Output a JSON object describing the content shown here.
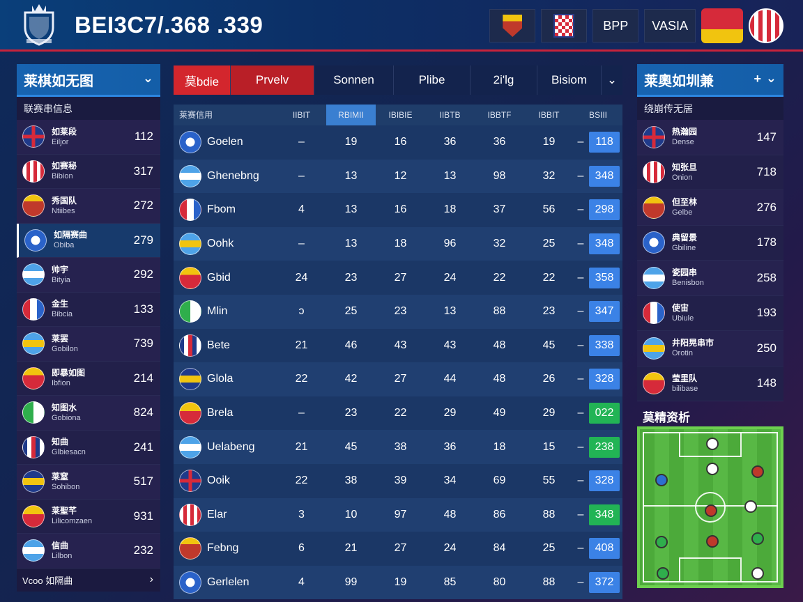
{
  "header": {
    "title": "BEI3C7/.368 .339",
    "buttons": [
      "BPP",
      "VASIA"
    ]
  },
  "left_panel": {
    "title": "莱棋如无图",
    "subtitle": "联赛串信息",
    "items": [
      {
        "name": "如莱段",
        "sub": "Eiljor",
        "value": "112"
      },
      {
        "name": "如赛秘",
        "sub": "Bibion",
        "value": "317"
      },
      {
        "name": "秀国队",
        "sub": "Ntiibes",
        "value": "272"
      },
      {
        "name": "如隔赛曲",
        "sub": "Obiba",
        "value": "279"
      },
      {
        "name": "帅宇",
        "sub": "Bityia",
        "value": "292"
      },
      {
        "name": "金生",
        "sub": "Bibcia",
        "value": "133"
      },
      {
        "name": "莱罢",
        "sub": "Gobilon",
        "value": "739"
      },
      {
        "name": "即暴如图",
        "sub": "Ibfion",
        "value": "214"
      },
      {
        "name": "知图水",
        "sub": "Gobiona",
        "value": "824"
      },
      {
        "name": "知曲",
        "sub": "Glbiesacn",
        "value": "241"
      },
      {
        "name": "莱窒",
        "sub": "Sohibon",
        "value": "517"
      },
      {
        "name": "莱聖芊",
        "sub": "Lilicomzaen",
        "value": "931"
      },
      {
        "name": "信曲",
        "sub": "Lilbon",
        "value": "232"
      }
    ],
    "footer": "Vcoo 如隔曲"
  },
  "tabs": [
    "莫bdie",
    "Prvelv",
    "Sonnen",
    "Plibe",
    "2i'lg",
    "Bisiom"
  ],
  "table": {
    "columns": [
      "莱赛信用",
      "IIBIT",
      "RBIMII",
      "IBIBIE",
      "IIBTB",
      "IBBTF",
      "IBBIT",
      "BSIII"
    ],
    "rows": [
      {
        "team": "Goelen",
        "v": [
          "–",
          "19",
          "16",
          "36",
          "36",
          "19"
        ],
        "score": "118",
        "score_color": "blue"
      },
      {
        "team": "Ghenebng",
        "v": [
          "–",
          "13",
          "12",
          "13",
          "98",
          "32"
        ],
        "score": "348",
        "score_color": "blue"
      },
      {
        "team": "Fbom",
        "v": [
          "4",
          "13",
          "16",
          "18",
          "37",
          "56"
        ],
        "score": "298",
        "score_color": "blue"
      },
      {
        "team": "Oohk",
        "v": [
          "–",
          "13",
          "18",
          "96",
          "32",
          "25"
        ],
        "score": "348",
        "score_color": "blue"
      },
      {
        "team": "Gbid",
        "v": [
          "24",
          "23",
          "27",
          "24",
          "22",
          "22"
        ],
        "score": "358",
        "score_color": "blue"
      },
      {
        "team": "Mlin",
        "v": [
          "ɔ",
          "25",
          "23",
          "13",
          "88",
          "23"
        ],
        "score": "347",
        "score_color": "blue"
      },
      {
        "team": "Bete",
        "v": [
          "21",
          "46",
          "43",
          "43",
          "48",
          "45"
        ],
        "score": "338",
        "score_color": "blue"
      },
      {
        "team": "Glola",
        "v": [
          "22",
          "42",
          "27",
          "44",
          "48",
          "26"
        ],
        "score": "328",
        "score_color": "blue"
      },
      {
        "team": "Brela",
        "v": [
          "–",
          "23",
          "22",
          "29",
          "49",
          "29"
        ],
        "score": "022",
        "score_color": "green"
      },
      {
        "team": "Uelabeng",
        "v": [
          "21",
          "45",
          "38",
          "36",
          "18",
          "15"
        ],
        "score": "238",
        "score_color": "green"
      },
      {
        "team": "Ooik",
        "v": [
          "22",
          "38",
          "39",
          "34",
          "69",
          "55"
        ],
        "score": "328",
        "score_color": "blue"
      },
      {
        "team": "Elar",
        "v": [
          "3",
          "10",
          "97",
          "48",
          "86",
          "88"
        ],
        "score": "348",
        "score_color": "green"
      },
      {
        "team": "Febng",
        "v": [
          "6",
          "21",
          "27",
          "24",
          "84",
          "25"
        ],
        "score": "408",
        "score_color": "blue"
      },
      {
        "team": "Gerlelen",
        "v": [
          "4",
          "99",
          "19",
          "85",
          "80",
          "88"
        ],
        "score": "372",
        "score_color": "blue"
      }
    ]
  },
  "right_panel": {
    "title": "莱奧如圳兼",
    "subtitle": "绕崩传无居",
    "items": [
      {
        "name": "热瀚园",
        "sub": "Dense",
        "value": "147"
      },
      {
        "name": "知张旦",
        "sub": "Onion",
        "value": "718"
      },
      {
        "name": "但至林",
        "sub": "Gelbe",
        "value": "276"
      },
      {
        "name": "典留景",
        "sub": "Gbiline",
        "value": "178"
      },
      {
        "name": "瓷园串",
        "sub": "Benisbon",
        "value": "258"
      },
      {
        "name": "使宙",
        "sub": "Ubiule",
        "value": "193"
      },
      {
        "name": "井阳晃串市",
        "sub": "Orotin",
        "value": "250"
      },
      {
        "name": "莹里队",
        "sub": "bilibase",
        "value": "148"
      }
    ]
  },
  "section_label": "莫精资析",
  "colors": {
    "accent_red": "#d3262d",
    "accent_blue": "#3a7fd1",
    "score_blue": "#3b82e6",
    "score_green": "#22b455"
  }
}
